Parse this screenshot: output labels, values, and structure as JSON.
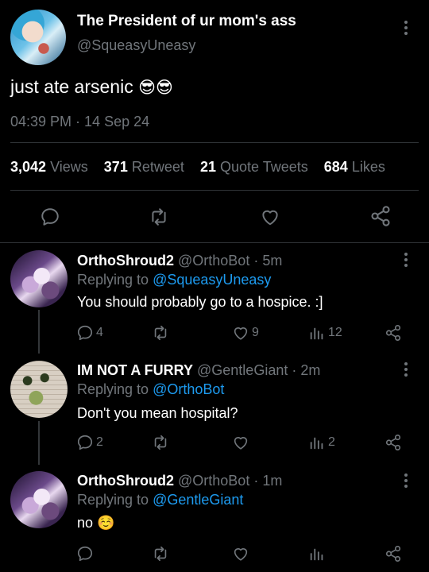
{
  "tweet": {
    "display_name": "The President of ur mom's ass",
    "handle": "@SqueasyUneasy",
    "text": "just ate arsenic",
    "emoji": "😎😎",
    "timestamp": "04:39 PM · 14 Sep 24",
    "stats": {
      "views_count": "3,042",
      "views_label": "Views",
      "retweets_count": "371",
      "retweets_label": "Retweet",
      "quotes_count": "21",
      "quotes_label": "Quote Tweets",
      "likes_count": "684",
      "likes_label": "Likes"
    }
  },
  "replies": [
    {
      "display_name": "OrthoShroud2",
      "meta": "@OrthoBot · 5m",
      "replying_prefix": "Replying to",
      "replying_to": "@SqueasyUneasy",
      "text": "You should probably go to a hospice. :]",
      "reply_count": "4",
      "like_count": "9",
      "view_count": "12"
    },
    {
      "display_name": "IM NOT A FURRY",
      "meta": "@GentleGiant · 2m",
      "replying_prefix": "Replying to",
      "replying_to": "@OrthoBot",
      "text": "Don't you mean hospital?",
      "reply_count": "2",
      "like_count": "",
      "view_count": "2"
    },
    {
      "display_name": "OrthoShroud2",
      "meta": "@OrthoBot · 1m",
      "replying_prefix": "Replying to",
      "replying_to": "@GentleGiant",
      "text": "no",
      "emoji": "☺️",
      "reply_count": "",
      "like_count": "",
      "view_count": ""
    }
  ],
  "colors": {
    "background": "#000000",
    "text": "#e7e9ea",
    "muted": "#71767b",
    "link": "#1d9bf0",
    "divider": "#2f3336"
  },
  "icons": [
    "more-icon",
    "reply-icon",
    "retweet-icon",
    "like-icon",
    "share-icon",
    "views-icon"
  ]
}
